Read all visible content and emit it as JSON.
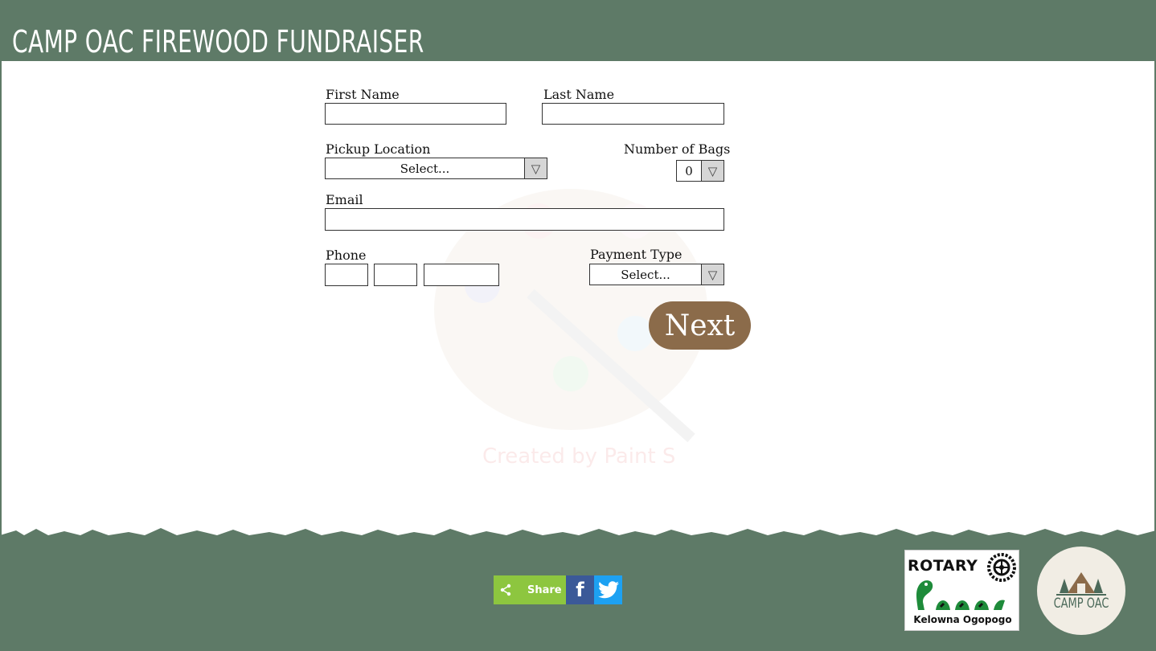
{
  "header": {
    "title": "CAMP OAC FIREWOOD FUNDRAISER"
  },
  "form": {
    "first_name": {
      "label": "First Name",
      "value": ""
    },
    "last_name": {
      "label": "Last Name",
      "value": ""
    },
    "pickup_location": {
      "label": "Pickup Location",
      "selected": "Select..."
    },
    "number_of_bags": {
      "label": "Number of Bags",
      "selected": "0"
    },
    "email": {
      "label": "Email",
      "value": ""
    },
    "phone": {
      "label": "Phone",
      "area": "",
      "prefix": "",
      "line": ""
    },
    "payment_type": {
      "label": "Payment Type",
      "selected": "Select..."
    },
    "next_button": "Next"
  },
  "watermark": {
    "text": "Created by Paint S"
  },
  "footer": {
    "share_label": "Share",
    "facebook_glyph": "f",
    "rotary": {
      "word": "ROTARY",
      "sub": "Kelowna Ogopogo"
    },
    "camp_logo": {
      "text": "CAMP OAC"
    }
  },
  "colors": {
    "header_bg": "#5e7a67",
    "button_brown": "#8b6b4a",
    "share_green": "#8dc63f",
    "facebook_blue": "#3b5998",
    "twitter_blue": "#1da1f2"
  }
}
